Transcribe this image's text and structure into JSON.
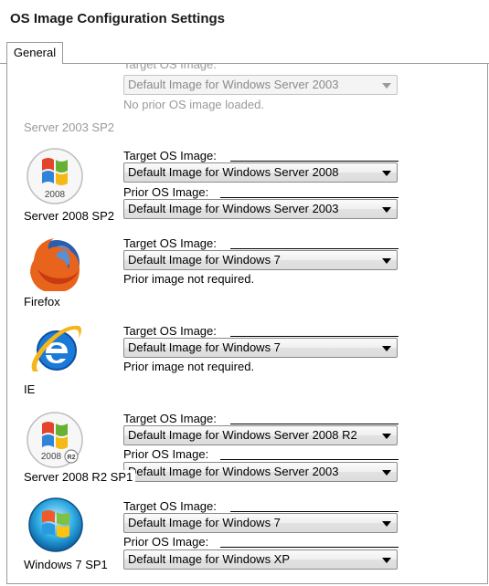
{
  "window": {
    "title": "OS Image Configuration Settings"
  },
  "tabs": [
    {
      "label": "General",
      "selected": true
    }
  ],
  "top_partial": {
    "target_label": "Target OS Image:",
    "target_value": "Default Image for Windows Server 2003",
    "prior_note": "No prior OS image loaded."
  },
  "section_label": "Server 2003 SP2",
  "entries": [
    {
      "name": "Server 2008 SP2",
      "icon": "windows-server-2008-icon",
      "target_label": "Target OS Image:",
      "target_value": "Default Image for Windows Server 2008",
      "prior_label": "Prior OS Image:",
      "prior_value": "Default Image for Windows Server 2003"
    },
    {
      "name": "Firefox",
      "icon": "firefox-icon",
      "target_label": "Target OS Image:",
      "target_value": "Default Image for Windows 7",
      "prior_note": "Prior image not required."
    },
    {
      "name": "IE",
      "icon": "internet-explorer-icon",
      "target_label": "Target OS Image:",
      "target_value": "Default Image for Windows 7",
      "prior_note": "Prior image not required."
    },
    {
      "name": "Server 2008 R2 SP1",
      "icon": "windows-server-2008-r2-icon",
      "target_label": "Target OS Image:",
      "target_value": "Default Image for Windows Server 2008 R2",
      "prior_label": "Prior OS Image:",
      "prior_value": "Default Image for Windows Server 2003"
    },
    {
      "name": "Windows 7 SP1",
      "icon": "windows-7-icon",
      "target_label": "Target OS Image:",
      "target_value": "Default Image for Windows 7",
      "prior_label": "Prior OS Image:",
      "prior_value": "Default Image for Windows XP"
    }
  ],
  "icon_text": {
    "server_2008": "2008",
    "r2_badge": "R2"
  }
}
